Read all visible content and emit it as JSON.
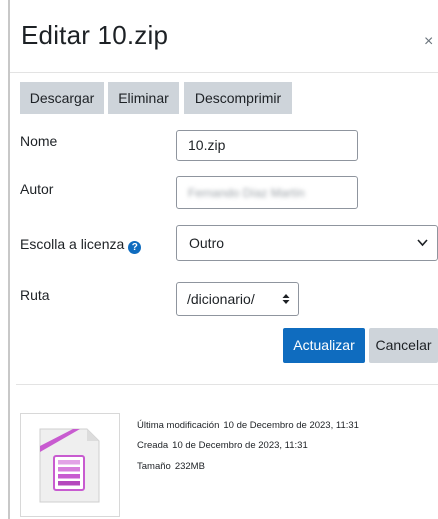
{
  "dialog": {
    "title": "Editar 10.zip",
    "close_symbol": "×"
  },
  "toolbar": {
    "download_label": "Descargar",
    "delete_label": "Eliminar",
    "unzip_label": "Descomprimir"
  },
  "form": {
    "name_label": "Nome",
    "name_value": "10.zip",
    "author_label": "Autor",
    "author_value": "Fernando Díaz Martín",
    "license_label": "Escolla a licenza",
    "license_value": "Outro",
    "path_label": "Ruta",
    "path_value": "/dicionario/"
  },
  "actions": {
    "update_label": "Actualizar",
    "cancel_label": "Cancelar"
  },
  "file_info": {
    "modified_label": "Última modificación",
    "modified_value": "10 de Decembro de 2023, 11:31",
    "created_label": "Creada",
    "created_value": "10 de Decembro de 2023, 11:31",
    "size_label": "Tamaño",
    "size_value": "232MB"
  },
  "colors": {
    "primary": "#0f6cbf",
    "secondary": "#ced4da",
    "archive_icon": "#c85bd0"
  }
}
